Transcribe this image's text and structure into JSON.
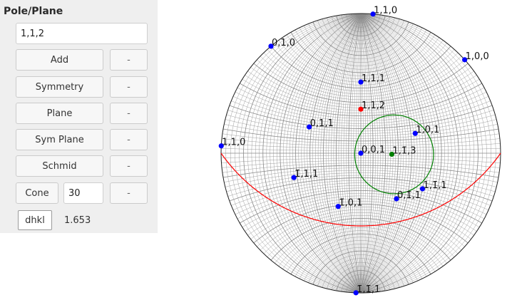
{
  "panel": {
    "title": "Pole/Plane",
    "pole_input": "1,1,2",
    "buttons": {
      "add": "Add",
      "symmetry": "Symmetry",
      "plane": "Plane",
      "sym_plane": "Sym Plane",
      "schmid": "Schmid",
      "cone": "Cone",
      "minus": "-"
    },
    "cone_angle": "30",
    "dhkl_button": "dhkl",
    "dhkl_value": "1.653"
  },
  "stereonet": {
    "colors": {
      "grid": "#8a8a8a",
      "outline": "#222222",
      "pole": "#0000ff",
      "selected_pole": "#ff0000",
      "cone_pole": "#008000",
      "plane_trace": "#ff0000",
      "cone_circle": "#008000"
    },
    "poles": [
      {
        "label": "1,1,0",
        "theta": 90,
        "phi": 355
      },
      {
        "label": "0,1,0",
        "theta": 90,
        "phi": 40
      },
      {
        "label": "1,0,0",
        "theta": 90,
        "phi": 312
      },
      {
        "label": "1,1,1",
        "theta": 54,
        "phi": 0
      },
      {
        "label": "0,1,1",
        "theta": 45,
        "phi": 63
      },
      {
        "label": "1,1,0",
        "theta": 90,
        "phi": 87
      },
      {
        "label": "1,0,1",
        "theta": 45,
        "phi": 290
      },
      {
        "label": "1̄,1,1",
        "theta": 54,
        "phi": 110
      },
      {
        "label": "0,0,1",
        "theta": 0,
        "phi": 0
      },
      {
        "label": "1,1̄,1",
        "theta": 54,
        "phi": 240
      },
      {
        "label": "1̄,0,1",
        "theta": 45,
        "phi": 157
      },
      {
        "label": "0,1̄,1",
        "theta": 45,
        "phi": 218
      },
      {
        "label": "1̄,1̄,1",
        "theta": 90,
        "phi": 178
      }
    ],
    "selected_pole": {
      "label": "1,1,2",
      "theta": 35,
      "phi": 0
    },
    "cone_pole": {
      "label": "1,1̄,3",
      "theta": 25,
      "phi": 268,
      "cone_angle": 30
    },
    "plane_trace": {
      "normal_theta": 35,
      "normal_phi": 0
    }
  }
}
